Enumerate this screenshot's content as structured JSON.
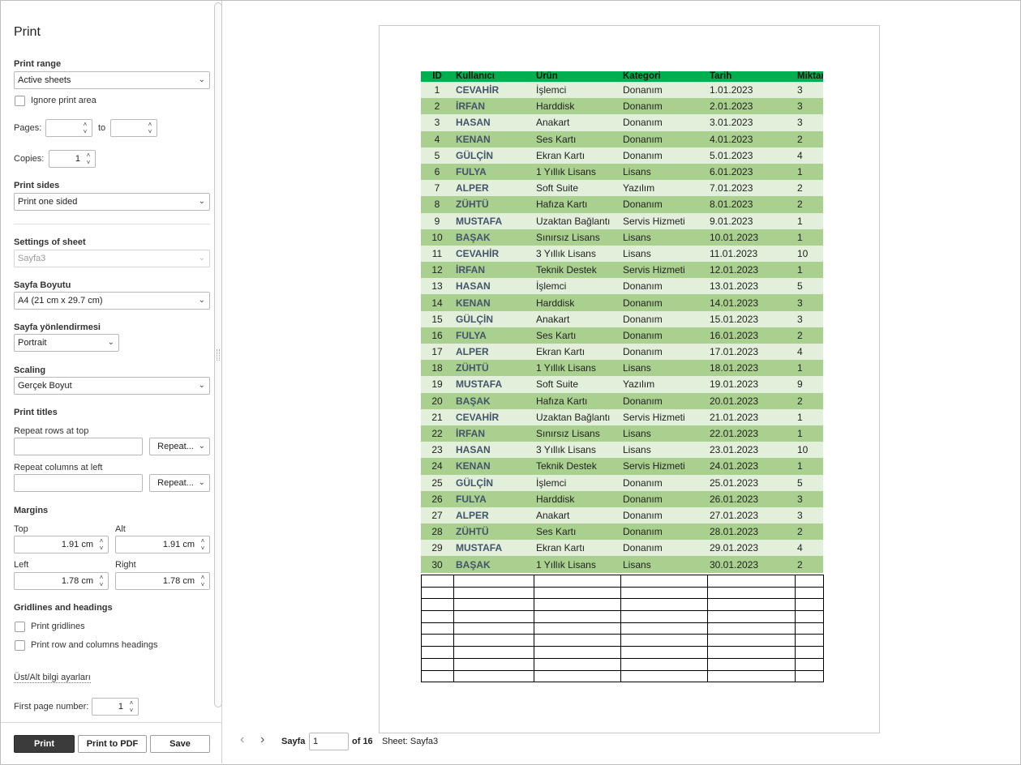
{
  "sidebar": {
    "title": "Print",
    "print_range": {
      "label": "Print range",
      "value": "Active sheets"
    },
    "ignore_print_area": "Ignore print area",
    "pages": {
      "label": "Pages:",
      "to": "to",
      "from_value": "",
      "to_value": ""
    },
    "copies": {
      "label": "Copies:",
      "value": "1"
    },
    "print_sides": {
      "label": "Print sides",
      "value": "Print one sided"
    },
    "settings_of_sheet": {
      "label": "Settings of sheet",
      "value": "Sayfa3"
    },
    "paper_size": {
      "label": "Sayfa Boyutu",
      "value": "A4 (21 cm x 29.7 cm)"
    },
    "orientation": {
      "label": "Sayfa yönlendirmesi",
      "value": "Portrait"
    },
    "scaling": {
      "label": "Scaling",
      "value": "Gerçek Boyut"
    },
    "print_titles": {
      "label": "Print titles",
      "rows_label": "Repeat rows at top",
      "rows_button": "Repeat...",
      "cols_label": "Repeat columns at left",
      "cols_button": "Repeat..."
    },
    "margins": {
      "label": "Margins",
      "top_label": "Top",
      "top_value": "1.91 cm",
      "bottom_label": "Alt",
      "bottom_value": "1.91 cm",
      "left_label": "Left",
      "left_value": "1.78 cm",
      "right_label": "Right",
      "right_value": "1.78 cm"
    },
    "gridlines": {
      "label": "Gridlines and headings",
      "print_gridlines": "Print gridlines",
      "print_headings": "Print row and columns headings"
    },
    "header_footer_link": "Üst/Alt bilgi ayarları",
    "first_page": {
      "label": "First page number:",
      "value": "1"
    },
    "buttons": {
      "print": "Print",
      "print_pdf": "Print to PDF",
      "save": "Save"
    }
  },
  "preview": {
    "columns": [
      "ID",
      "Kullanıcı",
      "Ürün",
      "Kategori",
      "Tarih",
      "Miktar"
    ],
    "rows": [
      [
        "1",
        "CEVAHİR",
        "İşlemci",
        "Donanım",
        "1.01.2023",
        "3"
      ],
      [
        "2",
        "İRFAN",
        "Harddisk",
        "Donanım",
        "2.01.2023",
        "3"
      ],
      [
        "3",
        "HASAN",
        "Anakart",
        "Donanım",
        "3.01.2023",
        "3"
      ],
      [
        "4",
        "KENAN",
        "Ses Kartı",
        "Donanım",
        "4.01.2023",
        "2"
      ],
      [
        "5",
        "GÜLÇİN",
        "Ekran Kartı",
        "Donanım",
        "5.01.2023",
        "4"
      ],
      [
        "6",
        "FULYA",
        "1 Yıllık Lisans",
        "Lisans",
        "6.01.2023",
        "1"
      ],
      [
        "7",
        "ALPER",
        "Soft Suite",
        "Yazılım",
        "7.01.2023",
        "2"
      ],
      [
        "8",
        "ZÜHTÜ",
        "Hafıza Kartı",
        "Donanım",
        "8.01.2023",
        "2"
      ],
      [
        "9",
        "MUSTAFA",
        "Uzaktan Bağlantı",
        "Servis Hizmeti",
        "9.01.2023",
        "1"
      ],
      [
        "10",
        "BAŞAK",
        "Sınırsız Lisans",
        "Lisans",
        "10.01.2023",
        "1"
      ],
      [
        "11",
        "CEVAHİR",
        "3 Yıllık Lisans",
        "Lisans",
        "11.01.2023",
        "10"
      ],
      [
        "12",
        "İRFAN",
        "Teknik Destek",
        "Servis Hizmeti",
        "12.01.2023",
        "1"
      ],
      [
        "13",
        "HASAN",
        "İşlemci",
        "Donanım",
        "13.01.2023",
        "5"
      ],
      [
        "14",
        "KENAN",
        "Harddisk",
        "Donanım",
        "14.01.2023",
        "3"
      ],
      [
        "15",
        "GÜLÇİN",
        "Anakart",
        "Donanım",
        "15.01.2023",
        "3"
      ],
      [
        "16",
        "FULYA",
        "Ses Kartı",
        "Donanım",
        "16.01.2023",
        "2"
      ],
      [
        "17",
        "ALPER",
        "Ekran Kartı",
        "Donanım",
        "17.01.2023",
        "4"
      ],
      [
        "18",
        "ZÜHTÜ",
        "1 Yıllık Lisans",
        "Lisans",
        "18.01.2023",
        "1"
      ],
      [
        "19",
        "MUSTAFA",
        "Soft Suite",
        "Yazılım",
        "19.01.2023",
        "9"
      ],
      [
        "20",
        "BAŞAK",
        "Hafıza Kartı",
        "Donanım",
        "20.01.2023",
        "2"
      ],
      [
        "21",
        "CEVAHİR",
        "Uzaktan Bağlantı",
        "Servis Hizmeti",
        "21.01.2023",
        "1"
      ],
      [
        "22",
        "İRFAN",
        "Sınırsız Lisans",
        "Lisans",
        "22.01.2023",
        "1"
      ],
      [
        "23",
        "HASAN",
        "3 Yıllık Lisans",
        "Lisans",
        "23.01.2023",
        "10"
      ],
      [
        "24",
        "KENAN",
        "Teknik Destek",
        "Servis Hizmeti",
        "24.01.2023",
        "1"
      ],
      [
        "25",
        "GÜLÇİN",
        "İşlemci",
        "Donanım",
        "25.01.2023",
        "5"
      ],
      [
        "26",
        "FULYA",
        "Harddisk",
        "Donanım",
        "26.01.2023",
        "3"
      ],
      [
        "27",
        "ALPER",
        "Anakart",
        "Donanım",
        "27.01.2023",
        "3"
      ],
      [
        "28",
        "ZÜHTÜ",
        "Ses Kartı",
        "Donanım",
        "28.01.2023",
        "2"
      ],
      [
        "29",
        "MUSTAFA",
        "Ekran Kartı",
        "Donanım",
        "29.01.2023",
        "4"
      ],
      [
        "30",
        "BAŞAK",
        "1 Yıllık Lisans",
        "Lisans",
        "30.01.2023",
        "2"
      ]
    ],
    "empty_rows": 9
  },
  "navigation": {
    "page_label": "Sayfa",
    "current_page": "1",
    "of_label": "of 16",
    "sheet_label": "Sheet: Sayfa3"
  },
  "colors": {
    "header_green": "#00b050",
    "row_light": "#e2efda",
    "row_dark": "#a9d08e",
    "user_text": "#44546a"
  }
}
